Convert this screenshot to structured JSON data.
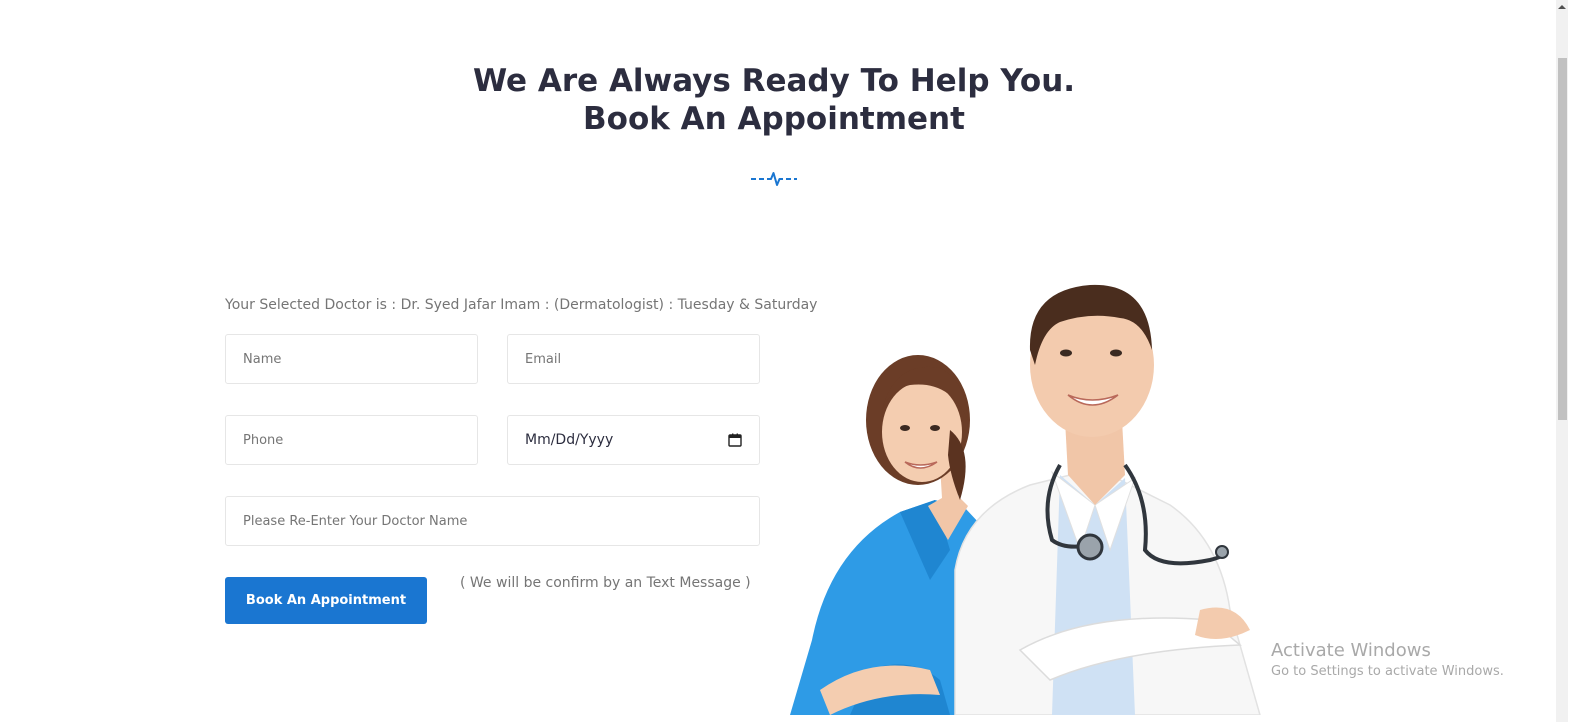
{
  "section": {
    "heading_line1": "We Are Always Ready To Help You.",
    "heading_line2": "Book An Appointment",
    "divider_icon": "heartbeat-icon"
  },
  "form": {
    "selected_doctor_text": "Your Selected Doctor is : Dr. Syed Jafar Imam : (Dermatologist) : Tuesday & Saturday",
    "name_placeholder": "Name",
    "email_placeholder": "Email",
    "phone_placeholder": "Phone",
    "date_placeholder": "Mm/Dd/Yyyy",
    "doctor_placeholder": "Please Re-Enter Your Doctor Name",
    "submit_label": "Book An Appointment",
    "confirm_note": "( We will be confirm by an Text Message )"
  },
  "watermark": {
    "line1": "Activate Windows",
    "line2": "Go to Settings to activate Windows."
  },
  "colors": {
    "primary": "#1a76d1",
    "heading": "#2c2d3f",
    "muted": "#757575"
  }
}
